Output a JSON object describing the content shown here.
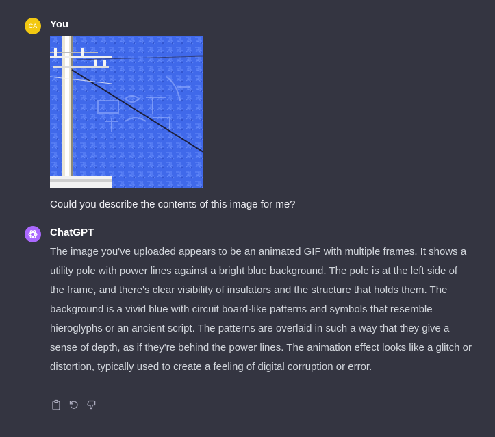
{
  "user_message": {
    "avatar_initials": "CA",
    "author": "You",
    "image_icon": "uploaded-image",
    "text": "Could you describe the contents of this image for me?"
  },
  "assistant_message": {
    "author": "ChatGPT",
    "avatar_icon": "openai-logo-icon",
    "text": "The image you've uploaded appears to be an animated GIF with multiple frames. It shows a utility pole with power lines against a bright blue background. The pole is at the left side of the frame, and there's clear visibility of insulators and the structure that holds them. The background is a vivid blue with circuit board-like patterns and symbols that resemble hieroglyphs or an ancient script. The patterns are overlaid in such a way that they give a sense of depth, as if they're behind the power lines. The animation effect looks like a glitch or distortion, typically used to create a feeling of digital corruption or error."
  },
  "actions": [
    "copy-icon",
    "regenerate-icon",
    "thumbs-down-icon"
  ],
  "colors": {
    "background": "#343541",
    "user_avatar": "#f2c811",
    "assistant_avatar": "#ab68ff",
    "text": "#d1d5db",
    "icon": "#acacbe"
  }
}
